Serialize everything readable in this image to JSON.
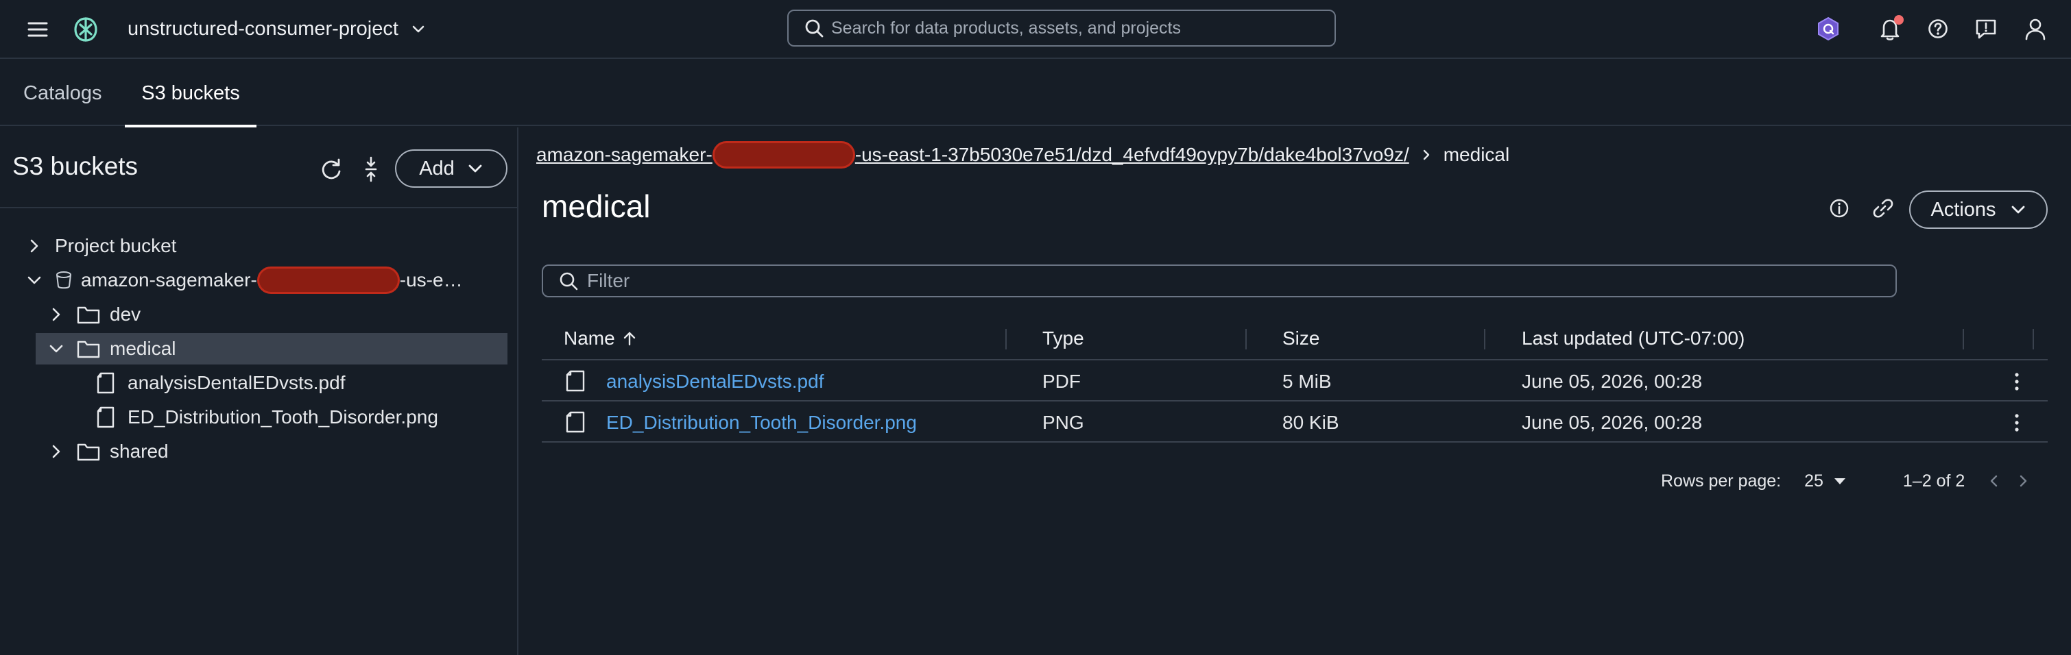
{
  "header": {
    "project_name": "unstructured-consumer-project",
    "search_placeholder": "Search for data products, assets, and projects"
  },
  "tabs": [
    {
      "label": "Catalogs",
      "active": false
    },
    {
      "label": "S3 buckets",
      "active": true
    }
  ],
  "left_pane": {
    "title": "S3 buckets",
    "add_label": "Add",
    "tree": {
      "project_bucket": "Project bucket",
      "bucket_prefix": "amazon-sagemaker-",
      "bucket_suffix": "-us-e…",
      "dev": "dev",
      "medical": "medical",
      "file1": "analysisDentalEDvsts.pdf",
      "file2": "ED_Distribution_Tooth_Disorder.png",
      "shared": "shared"
    }
  },
  "main": {
    "breadcrumb": {
      "path_prefix": "amazon-sagemaker-",
      "path_suffix": "-us-east-1-37b5030e7e51/dzd_4efvdf49oypy7b/dake4bol37vo9z/",
      "current": "medical"
    },
    "title": "medical",
    "actions_label": "Actions",
    "filter_placeholder": "Filter",
    "columns": {
      "name": "Name",
      "type": "Type",
      "size": "Size",
      "updated": "Last updated (UTC-07:00)"
    },
    "rows": [
      {
        "name": "analysisDentalEDvsts.pdf",
        "type": "PDF",
        "size": "5 MiB",
        "updated": "June 05, 2026, 00:28"
      },
      {
        "name": "ED_Distribution_Tooth_Disorder.png",
        "type": "PNG",
        "size": "80 KiB",
        "updated": "June 05, 2026, 00:28"
      }
    ],
    "pagination": {
      "rows_per_page_label": "Rows per page:",
      "rows_per_page": "25",
      "range": "1–2 of 2"
    }
  },
  "colors": {
    "background": "#161d26",
    "link": "#5aa7ec",
    "selected_row": "#3a424e",
    "redaction": "#8b1d12",
    "notification_dot": "#f26b6b",
    "brand_icon": "#6e56cf"
  }
}
